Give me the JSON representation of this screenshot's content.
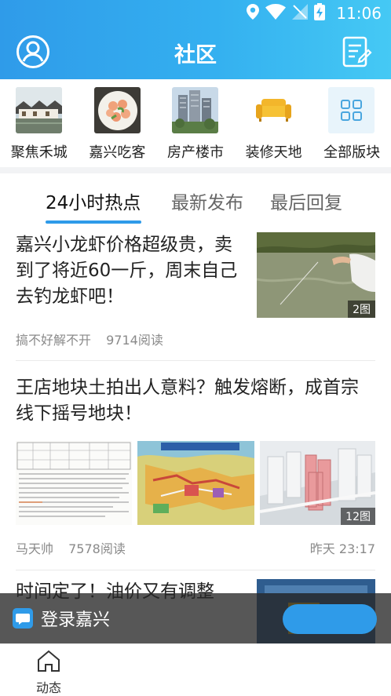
{
  "status": {
    "time": "11:06"
  },
  "header": {
    "title": "社区"
  },
  "categories": [
    {
      "label": "聚焦禾城",
      "icon": "town-photo"
    },
    {
      "label": "嘉兴吃客",
      "icon": "food-photo"
    },
    {
      "label": "房产楼市",
      "icon": "building-photo"
    },
    {
      "label": "装修天地",
      "icon": "sofa-icon"
    },
    {
      "label": "全部版块",
      "icon": "grid-icon"
    }
  ],
  "tabs": [
    {
      "label": "24小时热点",
      "active": true
    },
    {
      "label": "最新发布",
      "active": false
    },
    {
      "label": "最后回复",
      "active": false
    }
  ],
  "posts": [
    {
      "title": "嘉兴小龙虾价格超级贵，卖到了将近60一斤，周末自己去钓龙虾吧！",
      "author": "搞不好解不开",
      "reads": "9714阅读",
      "image_badge": "2图"
    },
    {
      "title": "王店地块土拍出人意料？触发熔断，成首宗线下摇号地块！",
      "author": "马天帅",
      "reads": "7578阅读",
      "time": "昨天 23:17",
      "image_badge": "12图"
    },
    {
      "title": "时间定了！油价又有调整"
    }
  ],
  "login_banner": {
    "text": "登录嘉兴"
  },
  "bottom_nav": {
    "label": "动态"
  },
  "colors": {
    "brand": "#2f9be9",
    "brand_light": "#45c9f4"
  }
}
